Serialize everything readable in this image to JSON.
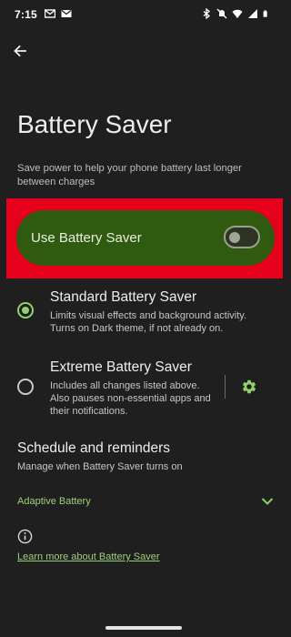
{
  "status_bar": {
    "time": "7:15",
    "left_icons": [
      "gmail-icon",
      "mail-icon"
    ],
    "right_icons": [
      "bluetooth-icon",
      "mute-icon",
      "wifi-icon",
      "signal-icon",
      "battery-icon"
    ]
  },
  "header": {
    "back_icon": "arrow-left-icon",
    "title": "Battery Saver"
  },
  "intro": {
    "description": "Save power to help your phone battery last longer between charges"
  },
  "main_toggle": {
    "label": "Use Battery Saver",
    "state": "off",
    "highlight_color": "#e6001c",
    "card_color": "#2f5a10"
  },
  "modes": [
    {
      "title": "Standard Battery Saver",
      "description": "Limits visual effects and background activity. Turns on Dark theme, if not already on.",
      "selected": true
    },
    {
      "title": "Extreme Battery Saver",
      "description": "Includes all changes listed above. Also pauses non-essential apps and their notifications.",
      "selected": false,
      "settings_icon": "gear-icon"
    }
  ],
  "schedule": {
    "title": "Schedule and reminders",
    "description": "Manage when Battery Saver turns on"
  },
  "adaptive": {
    "label": "Adaptive Battery",
    "icon": "chevron-down-icon"
  },
  "footer": {
    "info_icon": "info-icon",
    "link": "Learn more about Battery Saver"
  },
  "colors": {
    "background": "#1f1f1f",
    "accent": "#8fd16a",
    "link": "#9ccf7c"
  }
}
